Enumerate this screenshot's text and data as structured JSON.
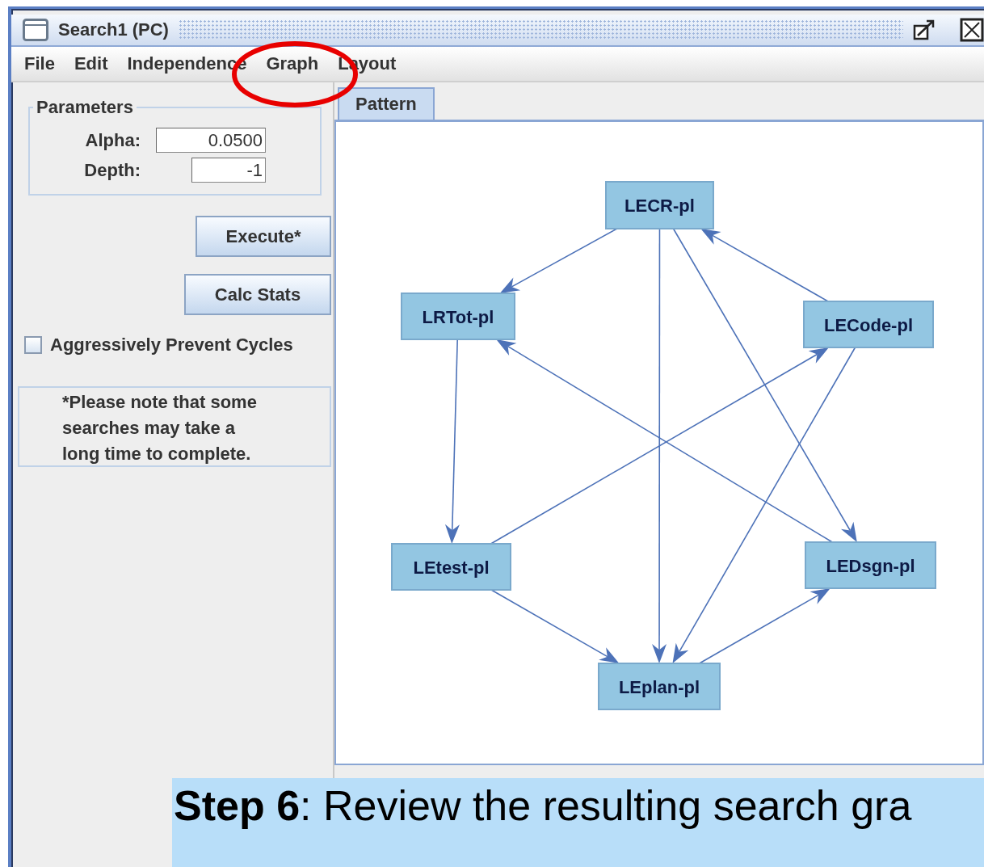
{
  "window": {
    "title": "Search1 (PC)"
  },
  "menu": [
    "File",
    "Edit",
    "Independence",
    "Graph",
    "Layout"
  ],
  "parameters": {
    "title": "Parameters",
    "fields": [
      {
        "label": "Alpha:",
        "value": "0.0500"
      },
      {
        "label": "Depth:",
        "value": "-1"
      }
    ]
  },
  "buttons": [
    "Execute*",
    "Calc Stats"
  ],
  "checkbox": {
    "label": "Aggressively Prevent Cycles",
    "checked": false
  },
  "note": "*Please note that some searches may take a long time to complete.",
  "tabs": [
    {
      "label": "Pattern",
      "selected": true
    }
  ],
  "graph": {
    "nodes": [
      "LECR-pl",
      "LRTot-pl",
      "LECode-pl",
      "LEtest-pl",
      "LEDsgn-pl",
      "LEplan-pl"
    ],
    "edges": [
      {
        "kind": "directed"
      },
      {
        "kind": "directed"
      },
      {
        "kind": "directed"
      },
      {
        "kind": "directed"
      },
      {
        "kind": "directed"
      },
      {
        "kind": "directed"
      },
      {
        "kind": "directed"
      },
      {
        "kind": "directed"
      },
      {
        "kind": "directed"
      },
      {
        "kind": "directed"
      }
    ]
  },
  "caption": {
    "lines": [
      "**Step 6**: Review the resulting search gra"
    ]
  }
}
